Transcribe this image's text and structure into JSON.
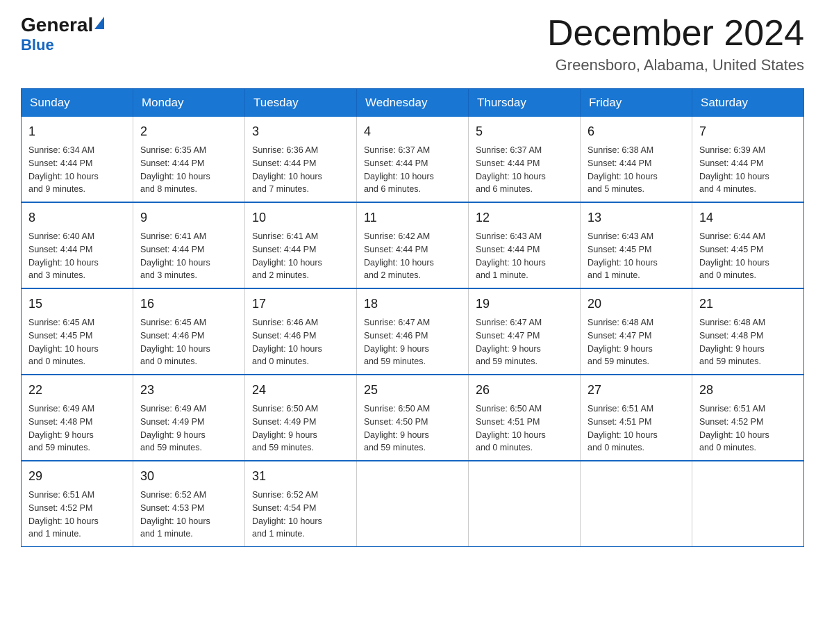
{
  "header": {
    "logo_general": "General",
    "logo_blue": "Blue",
    "month_title": "December 2024",
    "location": "Greensboro, Alabama, United States"
  },
  "weekdays": [
    "Sunday",
    "Monday",
    "Tuesday",
    "Wednesday",
    "Thursday",
    "Friday",
    "Saturday"
  ],
  "weeks": [
    [
      {
        "day": "1",
        "info": "Sunrise: 6:34 AM\nSunset: 4:44 PM\nDaylight: 10 hours\nand 9 minutes."
      },
      {
        "day": "2",
        "info": "Sunrise: 6:35 AM\nSunset: 4:44 PM\nDaylight: 10 hours\nand 8 minutes."
      },
      {
        "day": "3",
        "info": "Sunrise: 6:36 AM\nSunset: 4:44 PM\nDaylight: 10 hours\nand 7 minutes."
      },
      {
        "day": "4",
        "info": "Sunrise: 6:37 AM\nSunset: 4:44 PM\nDaylight: 10 hours\nand 6 minutes."
      },
      {
        "day": "5",
        "info": "Sunrise: 6:37 AM\nSunset: 4:44 PM\nDaylight: 10 hours\nand 6 minutes."
      },
      {
        "day": "6",
        "info": "Sunrise: 6:38 AM\nSunset: 4:44 PM\nDaylight: 10 hours\nand 5 minutes."
      },
      {
        "day": "7",
        "info": "Sunrise: 6:39 AM\nSunset: 4:44 PM\nDaylight: 10 hours\nand 4 minutes."
      }
    ],
    [
      {
        "day": "8",
        "info": "Sunrise: 6:40 AM\nSunset: 4:44 PM\nDaylight: 10 hours\nand 3 minutes."
      },
      {
        "day": "9",
        "info": "Sunrise: 6:41 AM\nSunset: 4:44 PM\nDaylight: 10 hours\nand 3 minutes."
      },
      {
        "day": "10",
        "info": "Sunrise: 6:41 AM\nSunset: 4:44 PM\nDaylight: 10 hours\nand 2 minutes."
      },
      {
        "day": "11",
        "info": "Sunrise: 6:42 AM\nSunset: 4:44 PM\nDaylight: 10 hours\nand 2 minutes."
      },
      {
        "day": "12",
        "info": "Sunrise: 6:43 AM\nSunset: 4:44 PM\nDaylight: 10 hours\nand 1 minute."
      },
      {
        "day": "13",
        "info": "Sunrise: 6:43 AM\nSunset: 4:45 PM\nDaylight: 10 hours\nand 1 minute."
      },
      {
        "day": "14",
        "info": "Sunrise: 6:44 AM\nSunset: 4:45 PM\nDaylight: 10 hours\nand 0 minutes."
      }
    ],
    [
      {
        "day": "15",
        "info": "Sunrise: 6:45 AM\nSunset: 4:45 PM\nDaylight: 10 hours\nand 0 minutes."
      },
      {
        "day": "16",
        "info": "Sunrise: 6:45 AM\nSunset: 4:46 PM\nDaylight: 10 hours\nand 0 minutes."
      },
      {
        "day": "17",
        "info": "Sunrise: 6:46 AM\nSunset: 4:46 PM\nDaylight: 10 hours\nand 0 minutes."
      },
      {
        "day": "18",
        "info": "Sunrise: 6:47 AM\nSunset: 4:46 PM\nDaylight: 9 hours\nand 59 minutes."
      },
      {
        "day": "19",
        "info": "Sunrise: 6:47 AM\nSunset: 4:47 PM\nDaylight: 9 hours\nand 59 minutes."
      },
      {
        "day": "20",
        "info": "Sunrise: 6:48 AM\nSunset: 4:47 PM\nDaylight: 9 hours\nand 59 minutes."
      },
      {
        "day": "21",
        "info": "Sunrise: 6:48 AM\nSunset: 4:48 PM\nDaylight: 9 hours\nand 59 minutes."
      }
    ],
    [
      {
        "day": "22",
        "info": "Sunrise: 6:49 AM\nSunset: 4:48 PM\nDaylight: 9 hours\nand 59 minutes."
      },
      {
        "day": "23",
        "info": "Sunrise: 6:49 AM\nSunset: 4:49 PM\nDaylight: 9 hours\nand 59 minutes."
      },
      {
        "day": "24",
        "info": "Sunrise: 6:50 AM\nSunset: 4:49 PM\nDaylight: 9 hours\nand 59 minutes."
      },
      {
        "day": "25",
        "info": "Sunrise: 6:50 AM\nSunset: 4:50 PM\nDaylight: 9 hours\nand 59 minutes."
      },
      {
        "day": "26",
        "info": "Sunrise: 6:50 AM\nSunset: 4:51 PM\nDaylight: 10 hours\nand 0 minutes."
      },
      {
        "day": "27",
        "info": "Sunrise: 6:51 AM\nSunset: 4:51 PM\nDaylight: 10 hours\nand 0 minutes."
      },
      {
        "day": "28",
        "info": "Sunrise: 6:51 AM\nSunset: 4:52 PM\nDaylight: 10 hours\nand 0 minutes."
      }
    ],
    [
      {
        "day": "29",
        "info": "Sunrise: 6:51 AM\nSunset: 4:52 PM\nDaylight: 10 hours\nand 1 minute."
      },
      {
        "day": "30",
        "info": "Sunrise: 6:52 AM\nSunset: 4:53 PM\nDaylight: 10 hours\nand 1 minute."
      },
      {
        "day": "31",
        "info": "Sunrise: 6:52 AM\nSunset: 4:54 PM\nDaylight: 10 hours\nand 1 minute."
      },
      null,
      null,
      null,
      null
    ]
  ]
}
